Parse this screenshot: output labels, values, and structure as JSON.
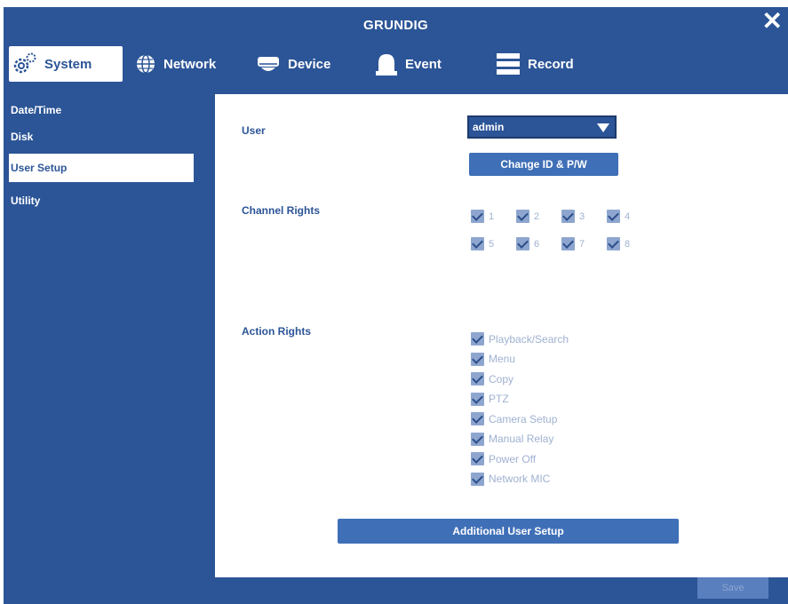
{
  "window": {
    "title": "GRUNDIG"
  },
  "tabs": [
    {
      "label": "System",
      "icon": "gears-icon",
      "active": true
    },
    {
      "label": "Network",
      "icon": "globe-icon",
      "active": false
    },
    {
      "label": "Device",
      "icon": "drive-icon",
      "active": false
    },
    {
      "label": "Event",
      "icon": "bell-icon",
      "active": false
    },
    {
      "label": "Record",
      "icon": "list-icon",
      "active": false
    }
  ],
  "sidebar": {
    "items": [
      {
        "label": "Date/Time"
      },
      {
        "label": "Disk"
      },
      {
        "label": "User Setup",
        "active": true
      },
      {
        "label": "Utility"
      }
    ]
  },
  "main": {
    "user_label": "User",
    "user_value": "admin",
    "change_btn": "Change ID & P/W",
    "channel_label": "Channel Rights",
    "channels": [
      "1",
      "2",
      "3",
      "4",
      "5",
      "6",
      "7",
      "8"
    ],
    "action_label": "Action Rights",
    "actions": [
      "Playback/Search",
      "Menu",
      "Copy",
      "PTZ",
      "Camera Setup",
      "Manual Relay",
      "Power Off",
      "Network MIC"
    ],
    "additional_btn": "Additional User Setup"
  },
  "footer": {
    "save_label": "Save"
  },
  "colors": {
    "frame": "#2c5597",
    "panel": "#ffffff",
    "button": "#3f6fb7"
  }
}
